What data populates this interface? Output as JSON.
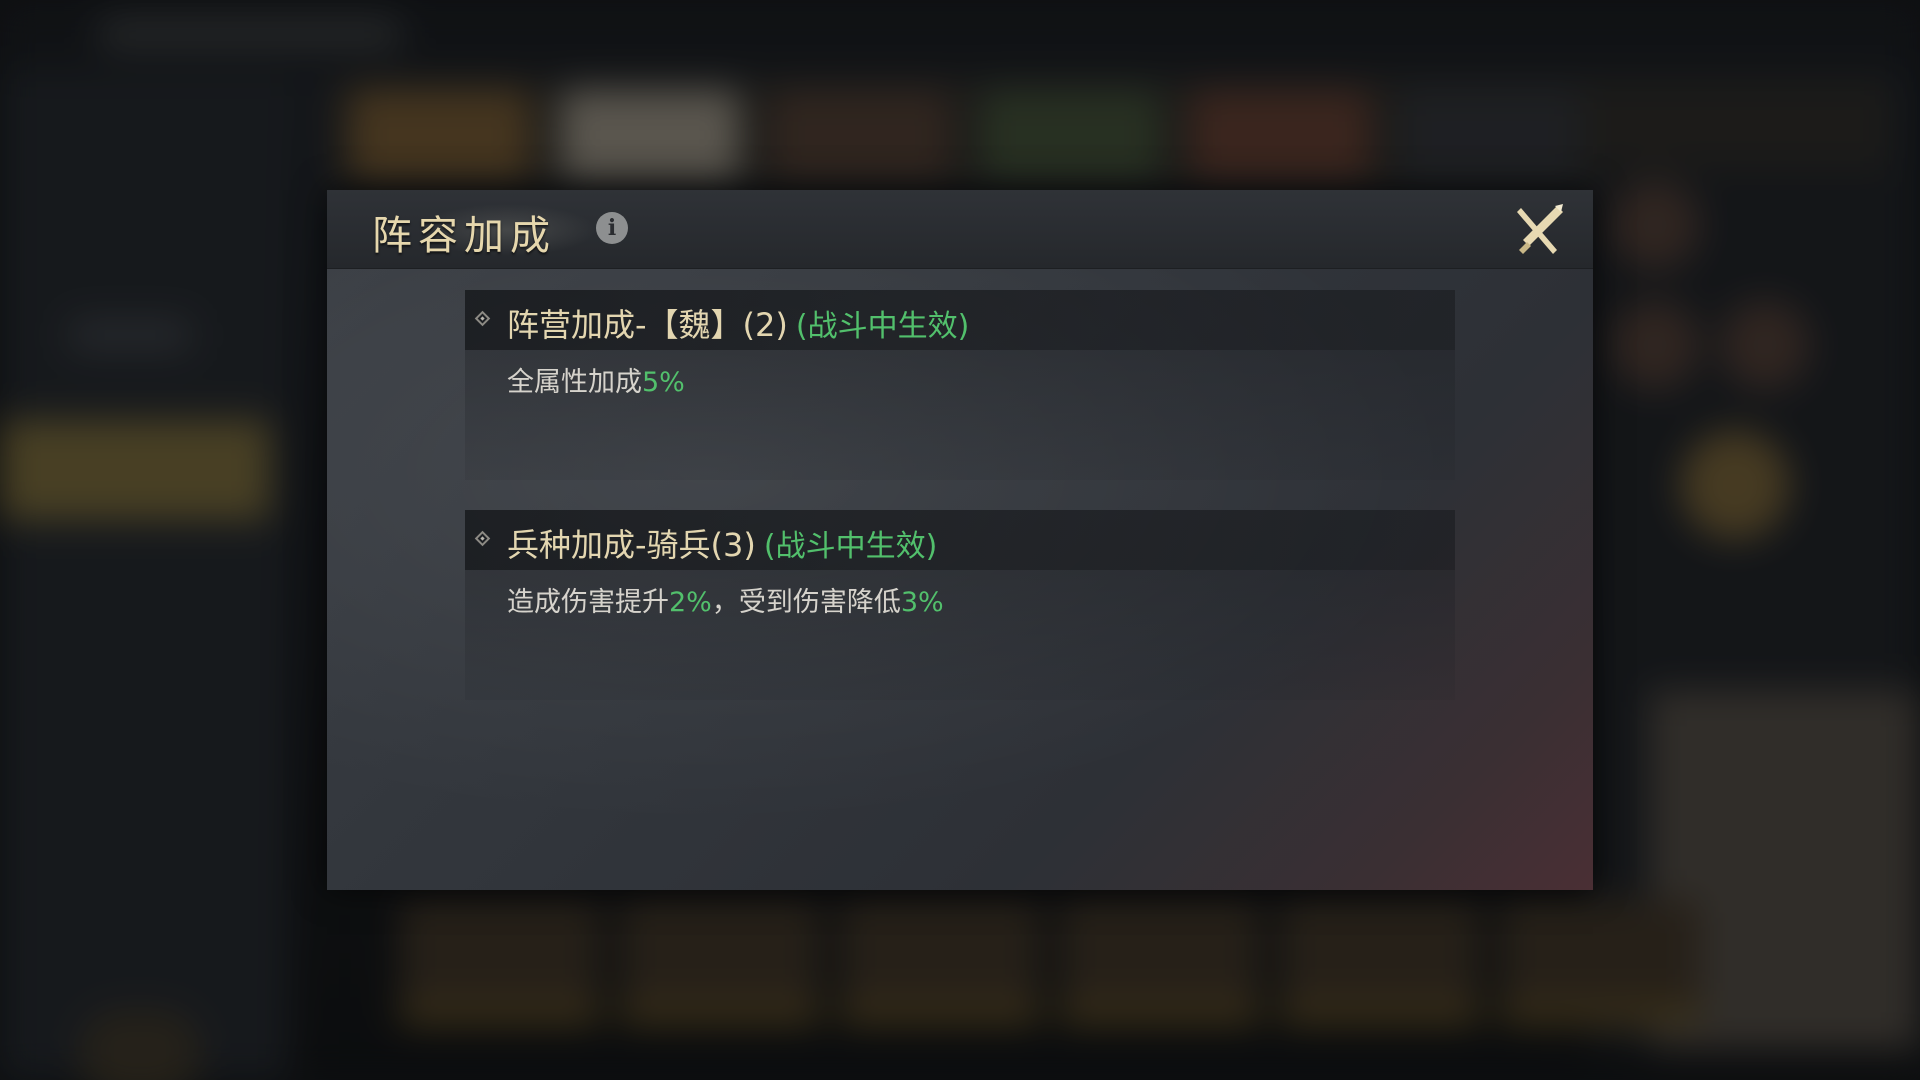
{
  "dialog": {
    "title": "阵容加成",
    "info_icon": "info-icon",
    "close_icon": "crossed-swords-close-icon"
  },
  "bonuses": [
    {
      "title": "阵营加成-【魏】(2)",
      "note": "(战斗中生效)",
      "desc_prefix": "全属性加成",
      "desc_value1": "5%",
      "desc_middle": "",
      "desc_value2": ""
    },
    {
      "title": "兵种加成-骑兵(3)",
      "note": "(战斗中生效)",
      "desc_prefix": "造成伤害提升",
      "desc_value1": "2%",
      "desc_middle": "，受到伤害降低",
      "desc_value2": "3%"
    }
  ],
  "colors": {
    "title_gold": "#e6d7ad",
    "effect_green": "#52c06c",
    "desc_text": "#d6d3cc"
  }
}
